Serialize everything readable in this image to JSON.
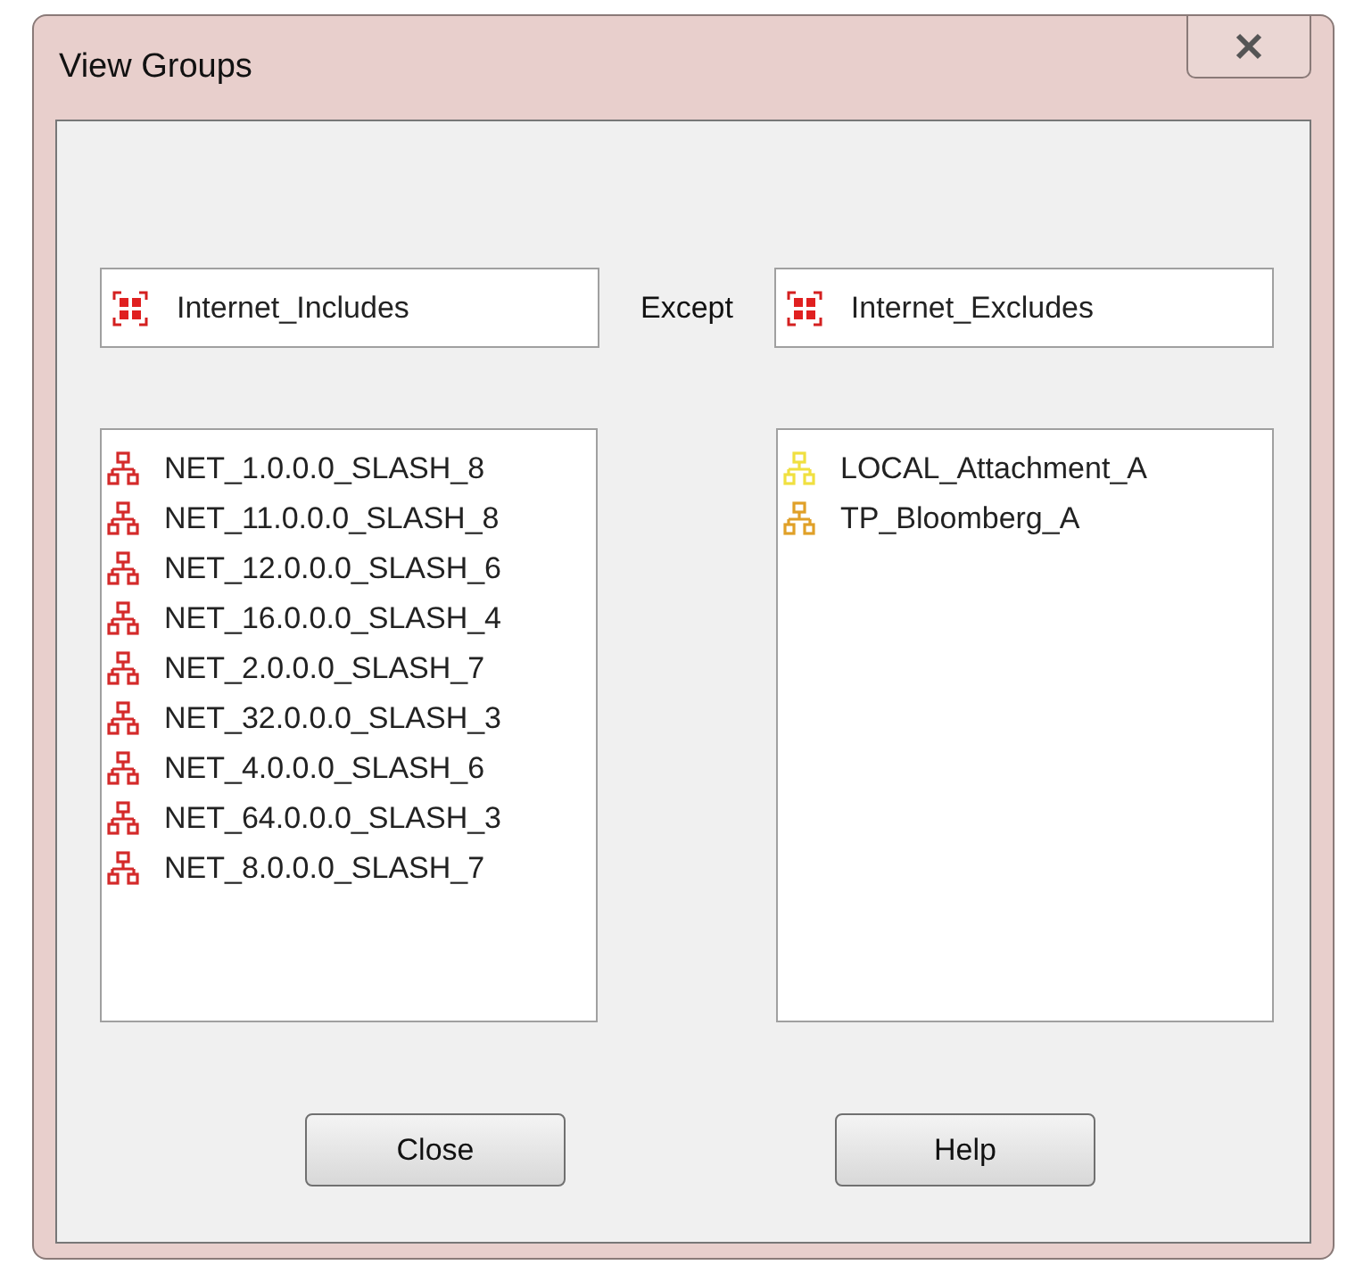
{
  "window": {
    "title": "View Groups"
  },
  "include_field": {
    "value": "Internet_Includes"
  },
  "except_label": "Except",
  "exclude_field": {
    "value": "Internet_Excludes"
  },
  "include_list": [
    {
      "name": "NET_1.0.0.0_SLASH_8",
      "color": "#d42a2a"
    },
    {
      "name": "NET_11.0.0.0_SLASH_8",
      "color": "#d42a2a"
    },
    {
      "name": "NET_12.0.0.0_SLASH_6",
      "color": "#d42a2a"
    },
    {
      "name": "NET_16.0.0.0_SLASH_4",
      "color": "#d42a2a"
    },
    {
      "name": "NET_2.0.0.0_SLASH_7",
      "color": "#d42a2a"
    },
    {
      "name": "NET_32.0.0.0_SLASH_3",
      "color": "#d42a2a"
    },
    {
      "name": "NET_4.0.0.0_SLASH_6",
      "color": "#d42a2a"
    },
    {
      "name": "NET_64.0.0.0_SLASH_3",
      "color": "#d42a2a"
    },
    {
      "name": "NET_8.0.0.0_SLASH_7",
      "color": "#d42a2a"
    }
  ],
  "exclude_list": [
    {
      "name": "LOCAL_Attachment_A",
      "color": "#f0e040"
    },
    {
      "name": "TP_Bloomberg_A",
      "color": "#e0a028"
    }
  ],
  "buttons": [
    "Close",
    "Help"
  ]
}
